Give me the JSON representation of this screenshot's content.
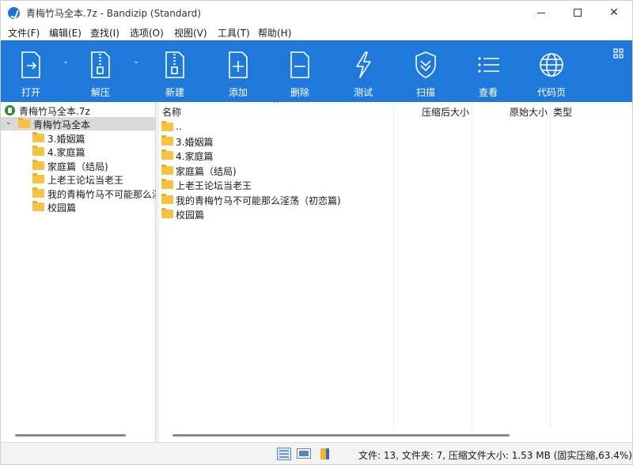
{
  "window": {
    "title": "青梅竹马全本.7z - Bandizip (Standard)"
  },
  "menu": [
    "文件(F)",
    "编辑(E)",
    "查找(I)",
    "选项(O)",
    "视图(V)",
    "工具(T)",
    "帮助(H)"
  ],
  "toolbar": {
    "open": "打开",
    "extract": "解压",
    "new": "新建",
    "add": "添加",
    "delete": "删除",
    "test": "测试",
    "scan": "扫描",
    "view": "查看",
    "codepage": "代码页"
  },
  "tree": {
    "root": "青梅竹马全本.7z",
    "folder": "青梅竹马全本",
    "children": [
      "3.婚姻篇",
      "4.家庭篇",
      "家庭篇（结局)",
      "上老王论坛当老王",
      "我的青梅竹马不可能那么淫",
      "校园篇"
    ]
  },
  "list": {
    "columns": {
      "name": "名称",
      "compressed": "压缩后大小",
      "original": "原始大小",
      "type": "类型"
    },
    "rows": [
      "..",
      "3.婚姻篇",
      "4.家庭篇",
      "家庭篇（结局)",
      "上老王论坛当老王",
      "我的青梅竹马不可能那么淫荡（初恋篇)",
      "校园篇"
    ]
  },
  "status": {
    "text": "文件: 13, 文件夹: 7, 压缩文件大小: 1.53 MB (固实压缩,63.4%)"
  },
  "colors": {
    "toolbar": "#1f79da",
    "folder": "#f5c242",
    "selected": "#d9d9d9"
  }
}
